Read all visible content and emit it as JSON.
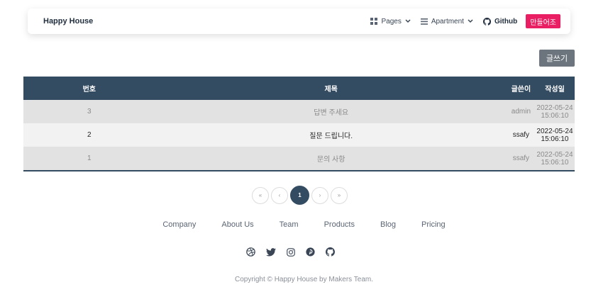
{
  "navbar": {
    "brand": "Happy House",
    "items": [
      {
        "label": "Pages",
        "icon": "grid-icon",
        "chevron": true
      },
      {
        "label": "Apartment",
        "icon": "list-icon",
        "chevron": true
      },
      {
        "label": "Github",
        "icon": "github-icon",
        "chevron": false
      }
    ],
    "cta_label": "만들어조"
  },
  "write_button_label": "글쓰기",
  "table": {
    "headers": [
      "번호",
      "제목",
      "글쓴이",
      "작성일"
    ],
    "rows": [
      {
        "no": "3",
        "title": "답변 주세요",
        "author": "admin",
        "date": "2022-05-24 15:06:10"
      },
      {
        "no": "2",
        "title": "질문 드립니다.",
        "author": "ssafy",
        "date": "2022-05-24 15:06:10"
      },
      {
        "no": "1",
        "title": "문의 사항",
        "author": "ssafy",
        "date": "2022-05-24 15:06:10"
      }
    ]
  },
  "pagination": {
    "first": "«",
    "prev": "‹",
    "current": "1",
    "next": "›",
    "last": "»"
  },
  "footer": {
    "links": [
      "Company",
      "About Us",
      "Team",
      "Products",
      "Blog",
      "Pricing"
    ],
    "social": [
      "dribbble-icon",
      "twitter-icon",
      "instagram-icon",
      "pinterest-icon",
      "github-icon"
    ],
    "copyright": "Copyright © Happy House by Makers Team."
  },
  "colors": {
    "header_bg": "#344c62",
    "accent": "#e91e63",
    "write_button": "#6c757d"
  }
}
